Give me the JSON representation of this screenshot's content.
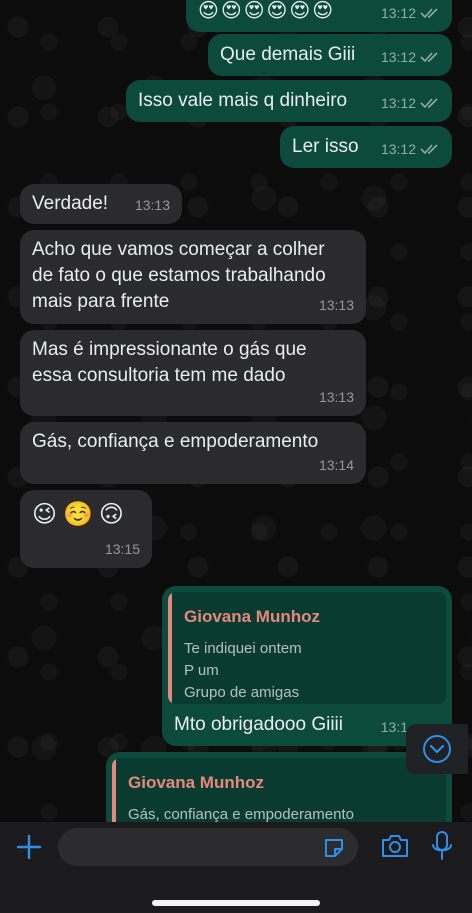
{
  "messages_out": [
    {
      "text": "😍😍😍😍😍😍",
      "time": "13:12"
    },
    {
      "text": "Que demais Giii",
      "time": "13:12"
    },
    {
      "text": "Isso vale mais q dinheiro",
      "time": "13:12"
    },
    {
      "text": "Ler isso",
      "time": "13:12"
    }
  ],
  "messages_in": [
    {
      "text": "Verdade!",
      "time": "13:13"
    },
    {
      "lines": [
        "Acho que vamos começar a colher",
        "de fato o que estamos trabalhando",
        "mais para frente"
      ],
      "time": "13:13"
    },
    {
      "lines": [
        "Mas é impressionante o gás que",
        "essa consultoria tem me dado"
      ],
      "time": "13:13"
    },
    {
      "text": "Gás, confiança e empoderamento",
      "time": "13:14"
    },
    {
      "text": "😉☺️🙃",
      "time": "13:15"
    }
  ],
  "reply_1": {
    "quoted_name": "Giovana Munhoz",
    "quoted_lines": [
      "Te indiquei ontem",
      "P um",
      "Grupo de amigas"
    ],
    "text": "Mto obrigadooo Giiii",
    "time": "13:1"
  },
  "reply_2": {
    "quoted_name": "Giovana Munhoz",
    "quoted_line": "Gás, confiança e empoderamento"
  },
  "colors": {
    "outgoing_bubble": "#0c4a3e",
    "incoming_bubble": "#2b2b2d",
    "accent_blue": "#2f8fe8",
    "quote_name": "#e6887b"
  },
  "icons": {
    "add": "plus-icon",
    "sticker": "sticker-icon",
    "camera": "camera-icon",
    "mic": "microphone-icon",
    "scroll": "chevron-down-circle-icon"
  }
}
